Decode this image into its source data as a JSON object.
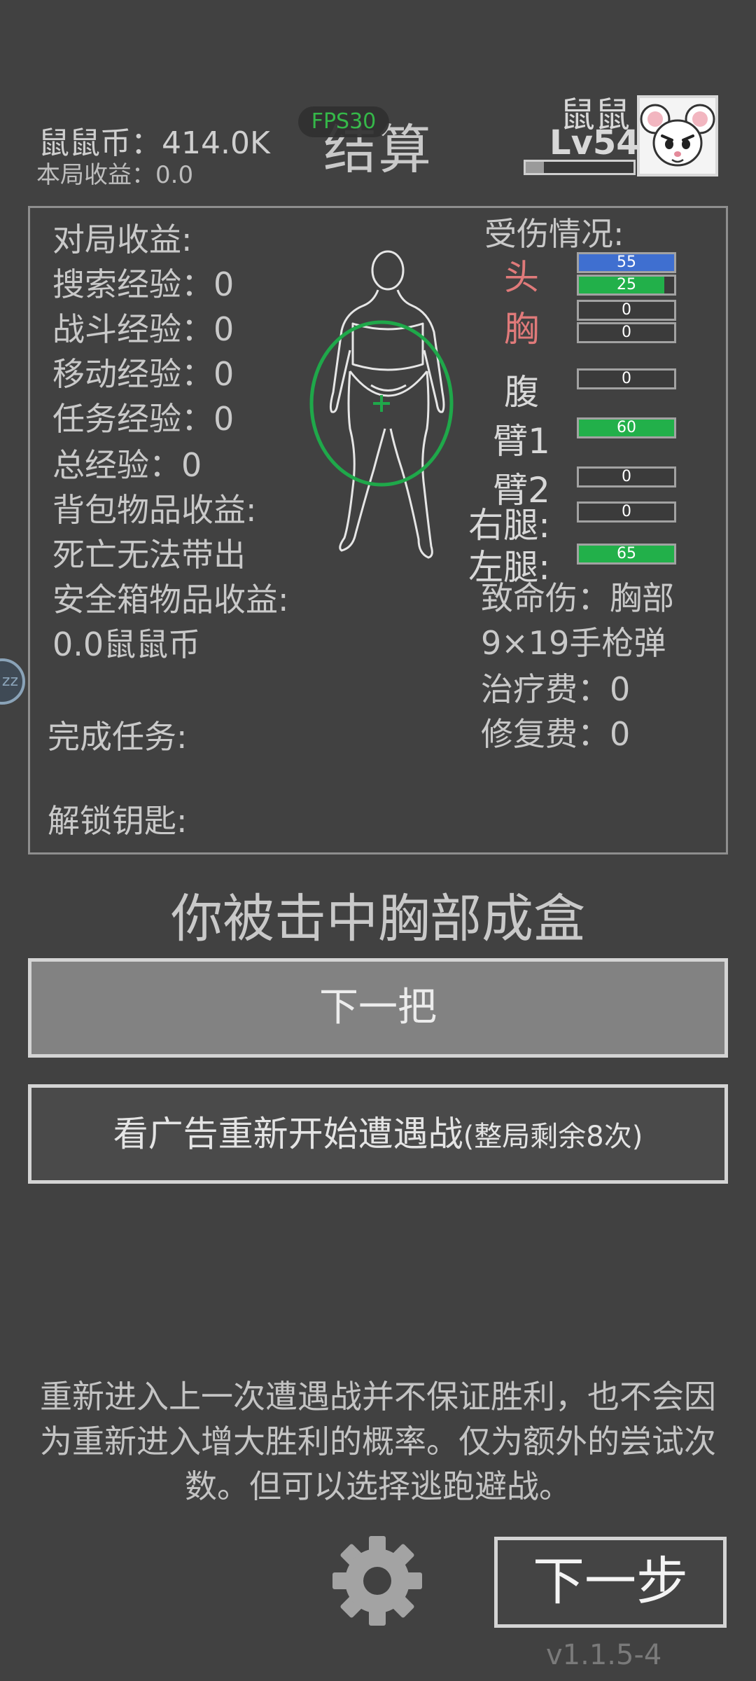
{
  "header": {
    "coins_text": "鼠鼠币：414.0K",
    "round_earnings_text": "本局收益：0.0",
    "title": "结算",
    "fps": "FPS30",
    "player_name": "鼠鼠",
    "player_level": "Lv54",
    "xp_progress": 0.17
  },
  "left_stats": {
    "heading": "对局收益:",
    "search_exp": "搜索经验：0",
    "combat_exp": "战斗经验：0",
    "move_exp": "移动经验：0",
    "task_exp": "任务经验：0",
    "total_exp": "总经验：0",
    "bag_earnings": "背包物品收益:",
    "bag_note": "死亡无法带出",
    "safe_earnings": "安全箱物品收益:",
    "safe_value": "0.0鼠鼠币",
    "tasks_done": "完成任务:",
    "unlock_key": "解锁钥匙:"
  },
  "injury": {
    "heading": "受伤情况:",
    "parts": [
      {
        "label": "头",
        "label_color": "#e07a7a",
        "bars": [
          {
            "value": "55",
            "fill": 1.0,
            "color": "#3f6fd0"
          },
          {
            "value": "25",
            "fill": 0.9,
            "color": "#22b04a"
          }
        ]
      },
      {
        "label": "胸",
        "label_color": "#e07a7a",
        "bars": [
          {
            "value": "0",
            "fill": 0,
            "color": "#22b04a"
          },
          {
            "value": "0",
            "fill": 0,
            "color": "#22b04a"
          }
        ]
      },
      {
        "label": "腹",
        "label_color": "#d8d8d8",
        "bars": [
          {
            "value": "0",
            "fill": 0,
            "color": "#22b04a"
          }
        ]
      },
      {
        "label": "臂1",
        "label_color": "#d8d8d8",
        "bars": [
          {
            "value": "60",
            "fill": 1.0,
            "color": "#22b04a"
          }
        ]
      },
      {
        "label": "臂2",
        "label_color": "#d8d8d8",
        "bars": [
          {
            "value": "0",
            "fill": 0,
            "color": "#22b04a"
          }
        ]
      },
      {
        "label": "右腿:",
        "label_color": "#d8d8d8",
        "bars": [
          {
            "value": "0",
            "fill": 0,
            "color": "#22b04a"
          }
        ]
      },
      {
        "label": "左腿:",
        "label_color": "#d8d8d8",
        "bars": [
          {
            "value": "65",
            "fill": 1.0,
            "color": "#22b04a"
          }
        ]
      }
    ],
    "fatal_wound": "致命伤：胸部",
    "ammo": "9×19手枪弹",
    "heal_cost": "治疗费：0",
    "repair_cost": "修复费：0"
  },
  "result_message": "你被击中胸部成盒",
  "buttons": {
    "next_round": "下一把",
    "retry_main": "看广告重新开始遭遇战",
    "retry_count": "(整局剩余8次)",
    "next_step": "下一步"
  },
  "notice": "重新进入上一次遭遇战并不保证胜利，也不会因为重新进入增大胜利的概率。仅为额外的尝试次数。但可以选择逃跑避战。",
  "version": "v1.1.5-4",
  "side_handle_text": "zz",
  "colors": {
    "hit_ring": "#1fa84a",
    "body_outline": "#e6e6e6"
  }
}
